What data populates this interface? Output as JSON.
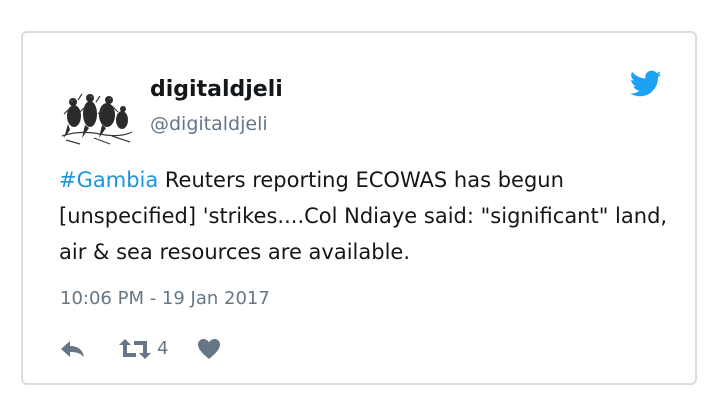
{
  "tweet": {
    "display_name": "digitaldjeli",
    "handle": "@digitaldjeli",
    "hashtag": "#Gambia",
    "text": " Reuters reporting ECOWAS has begun [unspecified] 'strikes....Col Ndiaye said: \"significant\" land, air & sea resources are available.",
    "timestamp": "10:06 PM - 19 Jan 2017",
    "retweet_count": "4"
  },
  "icons": {
    "brand": "twitter-bird-icon",
    "reply": "reply-icon",
    "retweet": "retweet-icon",
    "like": "heart-icon"
  },
  "colors": {
    "brand_blue": "#1da1f2",
    "hashtag": "#1b95e0",
    "muted_text": "#657786",
    "border": "#d9dde1",
    "text": "#14171a"
  }
}
